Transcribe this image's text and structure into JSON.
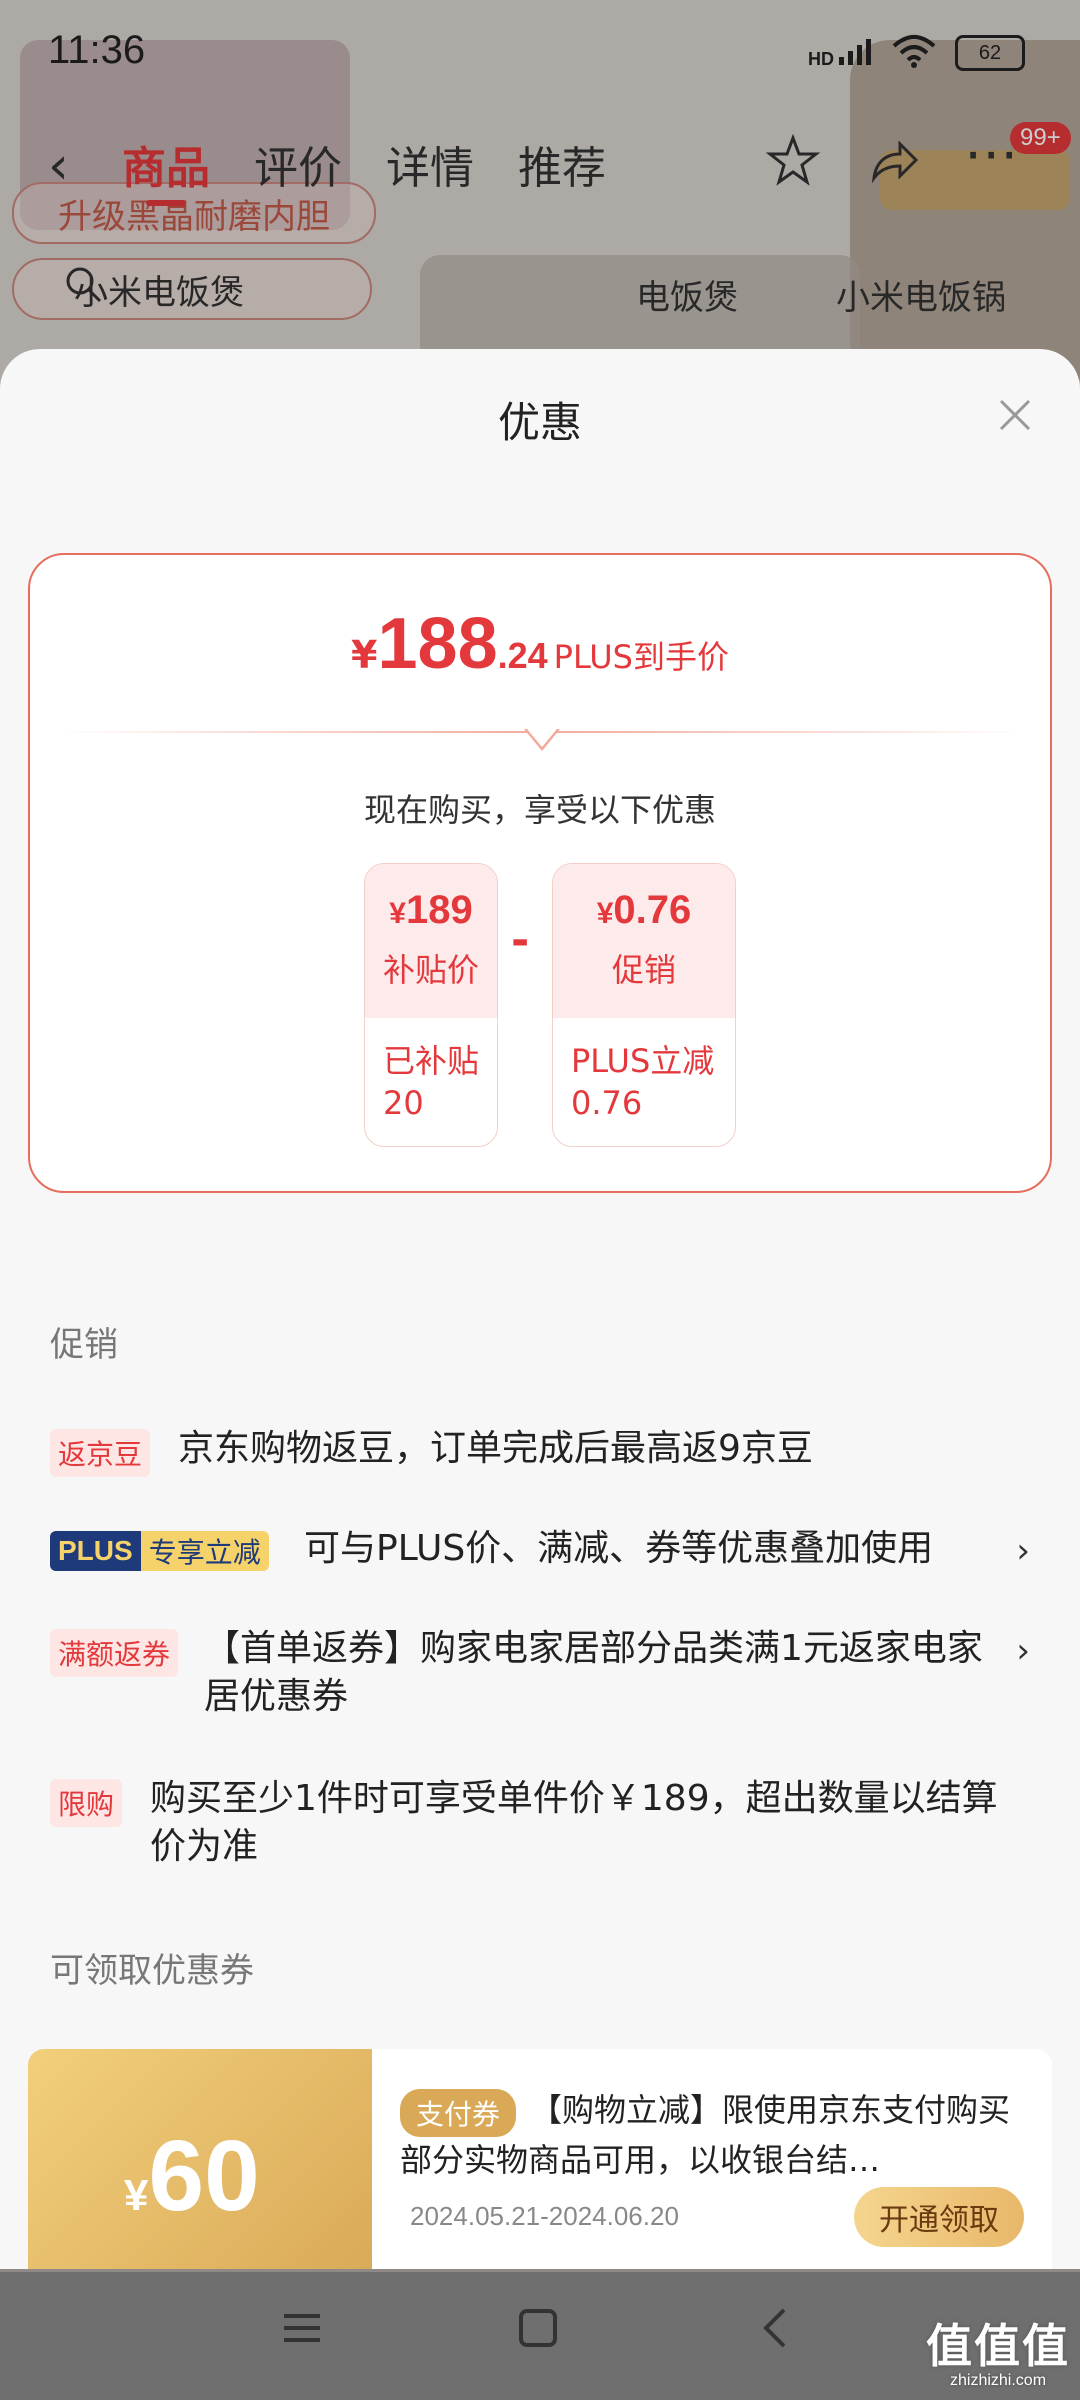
{
  "status_bar": {
    "time": "11:36",
    "battery": "62",
    "network": "HD"
  },
  "background": {
    "tabs": [
      "商品",
      "评价",
      "详情",
      "推荐"
    ],
    "cart_badge": "99+",
    "pill_text": "升级黑晶耐磨内胆",
    "search_text": "小米电饭煲",
    "links": [
      "电饭煲",
      "小米电饭锅"
    ]
  },
  "sheet": {
    "title": "优惠",
    "price": {
      "symbol": "¥",
      "integer": "188",
      "decimal": ".24",
      "label": "PLUS到手价"
    },
    "buy_text": "现在购买，享受以下优惠",
    "cards": [
      {
        "symbol": "¥",
        "amount": "189",
        "label": "补贴价",
        "detail": "已补贴20"
      },
      {
        "symbol": "¥",
        "amount": "0.76",
        "label": "促销",
        "detail": "PLUS立减0.76"
      }
    ],
    "minus": "-",
    "promo_section_title": "促销",
    "promos": [
      {
        "tag": "返京豆",
        "text": "京东购物返豆，订单完成后最高返9京豆"
      },
      {
        "tag_part1": "PLUS",
        "tag_part2": "专享立减",
        "text": "可与PLUS价、满减、券等优惠叠加使用"
      },
      {
        "tag": "满额返券",
        "text": "【首单返券】购家电家居部分品类满1元返家电家居优惠券"
      },
      {
        "tag": "限购",
        "text": "购买至少1件时可享受单件价￥189，超出数量以结算价为准"
      }
    ],
    "coupon_section_title": "可领取优惠券",
    "coupon": {
      "symbol": "¥",
      "amount": "60",
      "tag": "支付券",
      "description": "【购物立减】限使用京东支付购买部分实物商品可用，以收银台结…",
      "date_range": "2024.05.21-2024.06.20",
      "button": "开通领取"
    }
  },
  "watermark": {
    "main": "值值值",
    "sub": "zhizhizhi.com"
  },
  "colors": {
    "accent": "#e4393c",
    "coupon_gold": "#d9a957",
    "plus_navy": "#1e3a7b"
  }
}
